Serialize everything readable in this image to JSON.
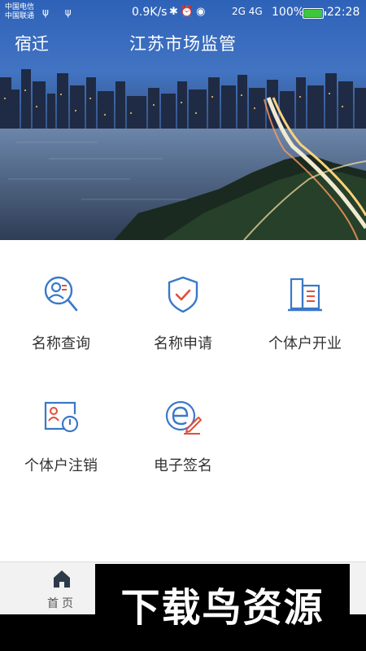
{
  "status_bar": {
    "carrier_1": "中国电信",
    "carrier_2": "中国联通",
    "usb_symbols": "ψ ψ",
    "net_speed": "0.9K/s",
    "indicator_icons": "✱⏰◉",
    "signal_labels": "2G 4G",
    "battery_percent": "100%",
    "battery_level": 1.0,
    "time": "22:28"
  },
  "header": {
    "city": "宿迁",
    "title": "江苏市场监管"
  },
  "services": [
    {
      "label": "名称查询",
      "icon": "name-search-icon"
    },
    {
      "label": "名称申请",
      "icon": "shield-check-icon"
    },
    {
      "label": "个体户开业",
      "icon": "building-icon"
    },
    {
      "label": "个体户注销",
      "icon": "id-card-power-icon"
    },
    {
      "label": "电子签名",
      "icon": "e-signature-icon"
    }
  ],
  "bottom_nav": {
    "home_label": "首页",
    "home_icon": "home-icon"
  },
  "watermark": {
    "text": "下载鸟资源"
  },
  "colors": {
    "icon_blue": "#3a78c9",
    "icon_red": "#e0503a",
    "label_text": "#333333",
    "nav_bg": "#f2f2f2"
  }
}
